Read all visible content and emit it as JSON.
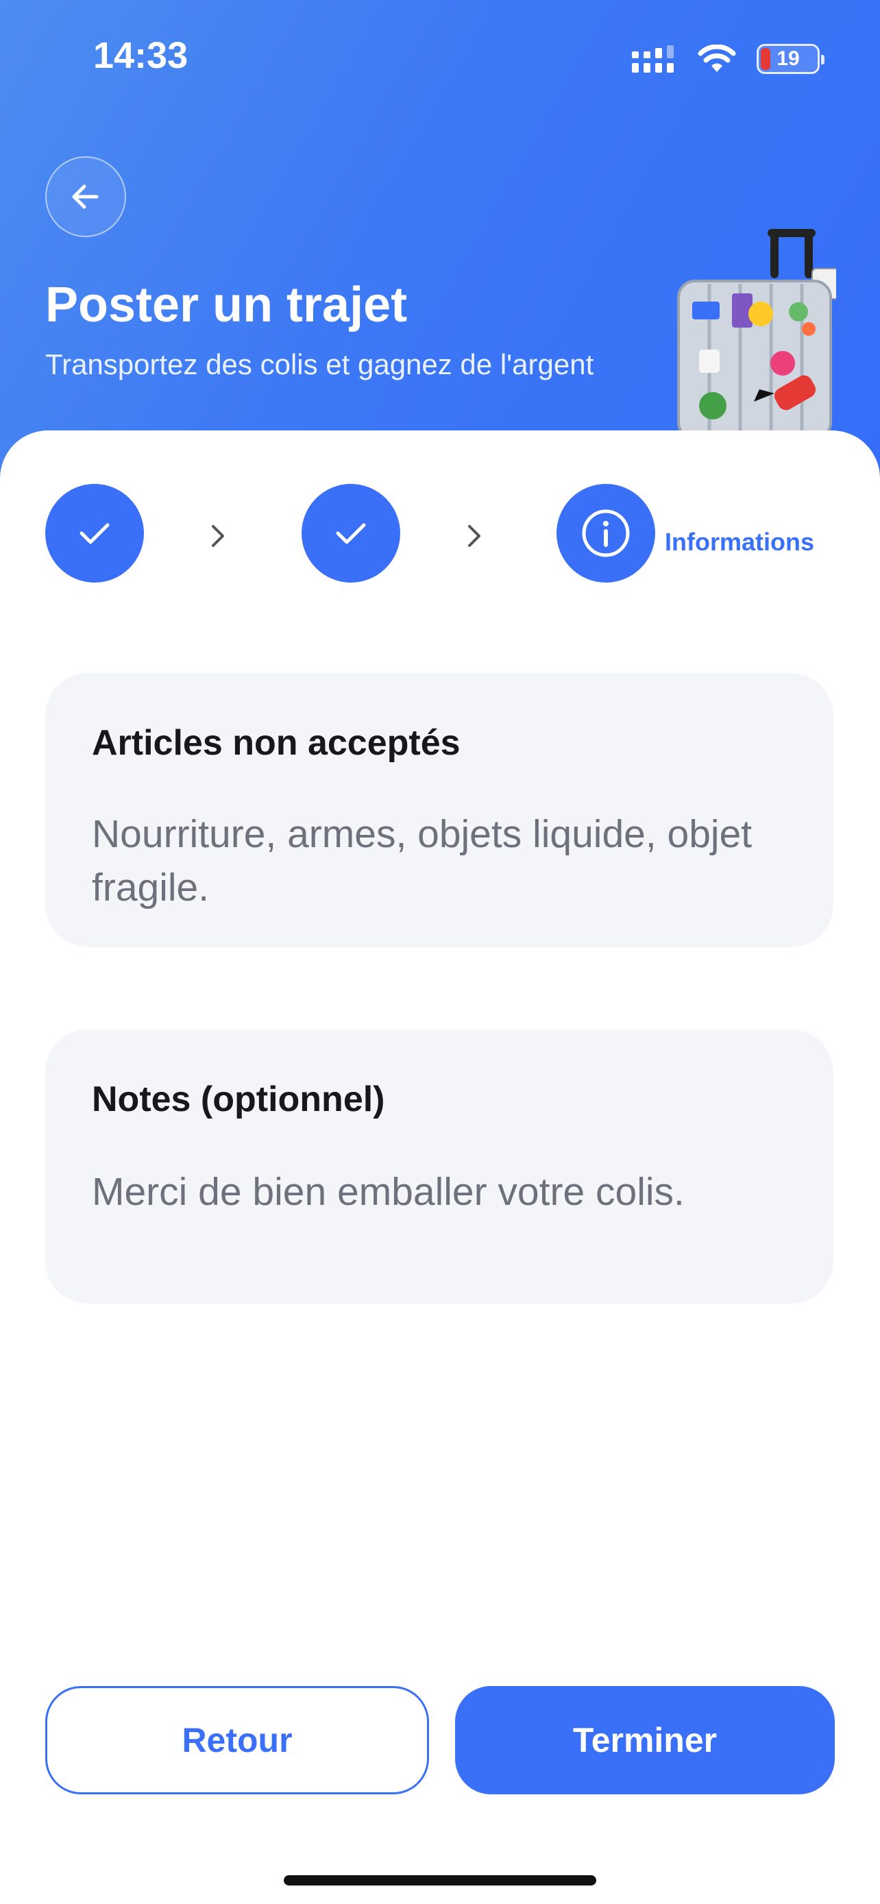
{
  "status_bar": {
    "time": "14:33",
    "battery": "19"
  },
  "header": {
    "title": "Poster un trajet",
    "subtitle": "Transportez des colis et gagnez de l'argent"
  },
  "stepper": {
    "steps": [
      {
        "state": "completed",
        "icon": "check-icon"
      },
      {
        "state": "completed",
        "icon": "check-icon"
      },
      {
        "state": "current",
        "icon": "info-icon",
        "label": "Informations"
      }
    ]
  },
  "cards": {
    "prohibited": {
      "title": "Articles non acceptés",
      "body": "Nourriture, armes, objets liquide, objet fragile."
    },
    "notes": {
      "title": "Notes (optionnel)",
      "body": "Merci de bien emballer votre colis."
    }
  },
  "actions": {
    "back_label": "Retour",
    "finish_label": "Terminer"
  },
  "colors": {
    "accent": "#3a6ff7",
    "card_bg": "#f3f5f9",
    "header_gradient_start": "#4d8cf0"
  }
}
